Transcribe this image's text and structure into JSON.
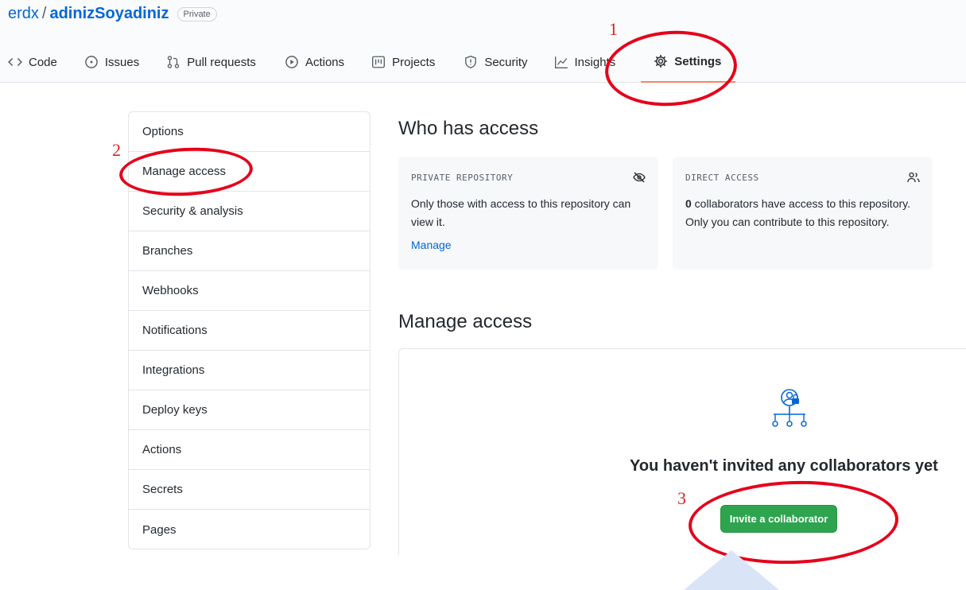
{
  "repo": {
    "owner": "erdx",
    "separator": "/",
    "name": "adinizSoyadiniz",
    "visibility": "Private"
  },
  "tabs": [
    {
      "label": "Code",
      "icon": "code-icon"
    },
    {
      "label": "Issues",
      "icon": "issue-icon"
    },
    {
      "label": "Pull requests",
      "icon": "pull-request-icon"
    },
    {
      "label": "Actions",
      "icon": "play-icon"
    },
    {
      "label": "Projects",
      "icon": "project-icon"
    },
    {
      "label": "Security",
      "icon": "shield-icon"
    },
    {
      "label": "Insights",
      "icon": "graph-icon"
    },
    {
      "label": "Settings",
      "icon": "gear-icon",
      "selected": true
    }
  ],
  "sidebar": {
    "items": [
      {
        "label": "Options"
      },
      {
        "label": "Manage access",
        "active": true
      },
      {
        "label": "Security & analysis"
      },
      {
        "label": "Branches"
      },
      {
        "label": "Webhooks"
      },
      {
        "label": "Notifications"
      },
      {
        "label": "Integrations"
      },
      {
        "label": "Deploy keys"
      },
      {
        "label": "Actions"
      },
      {
        "label": "Secrets"
      },
      {
        "label": "Pages"
      }
    ]
  },
  "who_has_access": {
    "title": "Who has access",
    "private_card": {
      "heading": "PRIVATE REPOSITORY",
      "icon": "eye-closed-icon",
      "body": "Only those with access to this repository can view it.",
      "link": "Manage"
    },
    "direct_card": {
      "heading": "DIRECT ACCESS",
      "icon": "people-icon",
      "count": "0",
      "body": " collaborators have access to this repository. Only you can contribute to this repository."
    }
  },
  "manage_access": {
    "title": "Manage access",
    "empty_icon": "collaborators-icon",
    "empty_text": "You haven't invited any collaborators yet",
    "invite_label": "Invite a collaborator"
  },
  "annotations": {
    "step1": "1",
    "step2": "2",
    "step3": "3",
    "color": "#e6001a"
  }
}
